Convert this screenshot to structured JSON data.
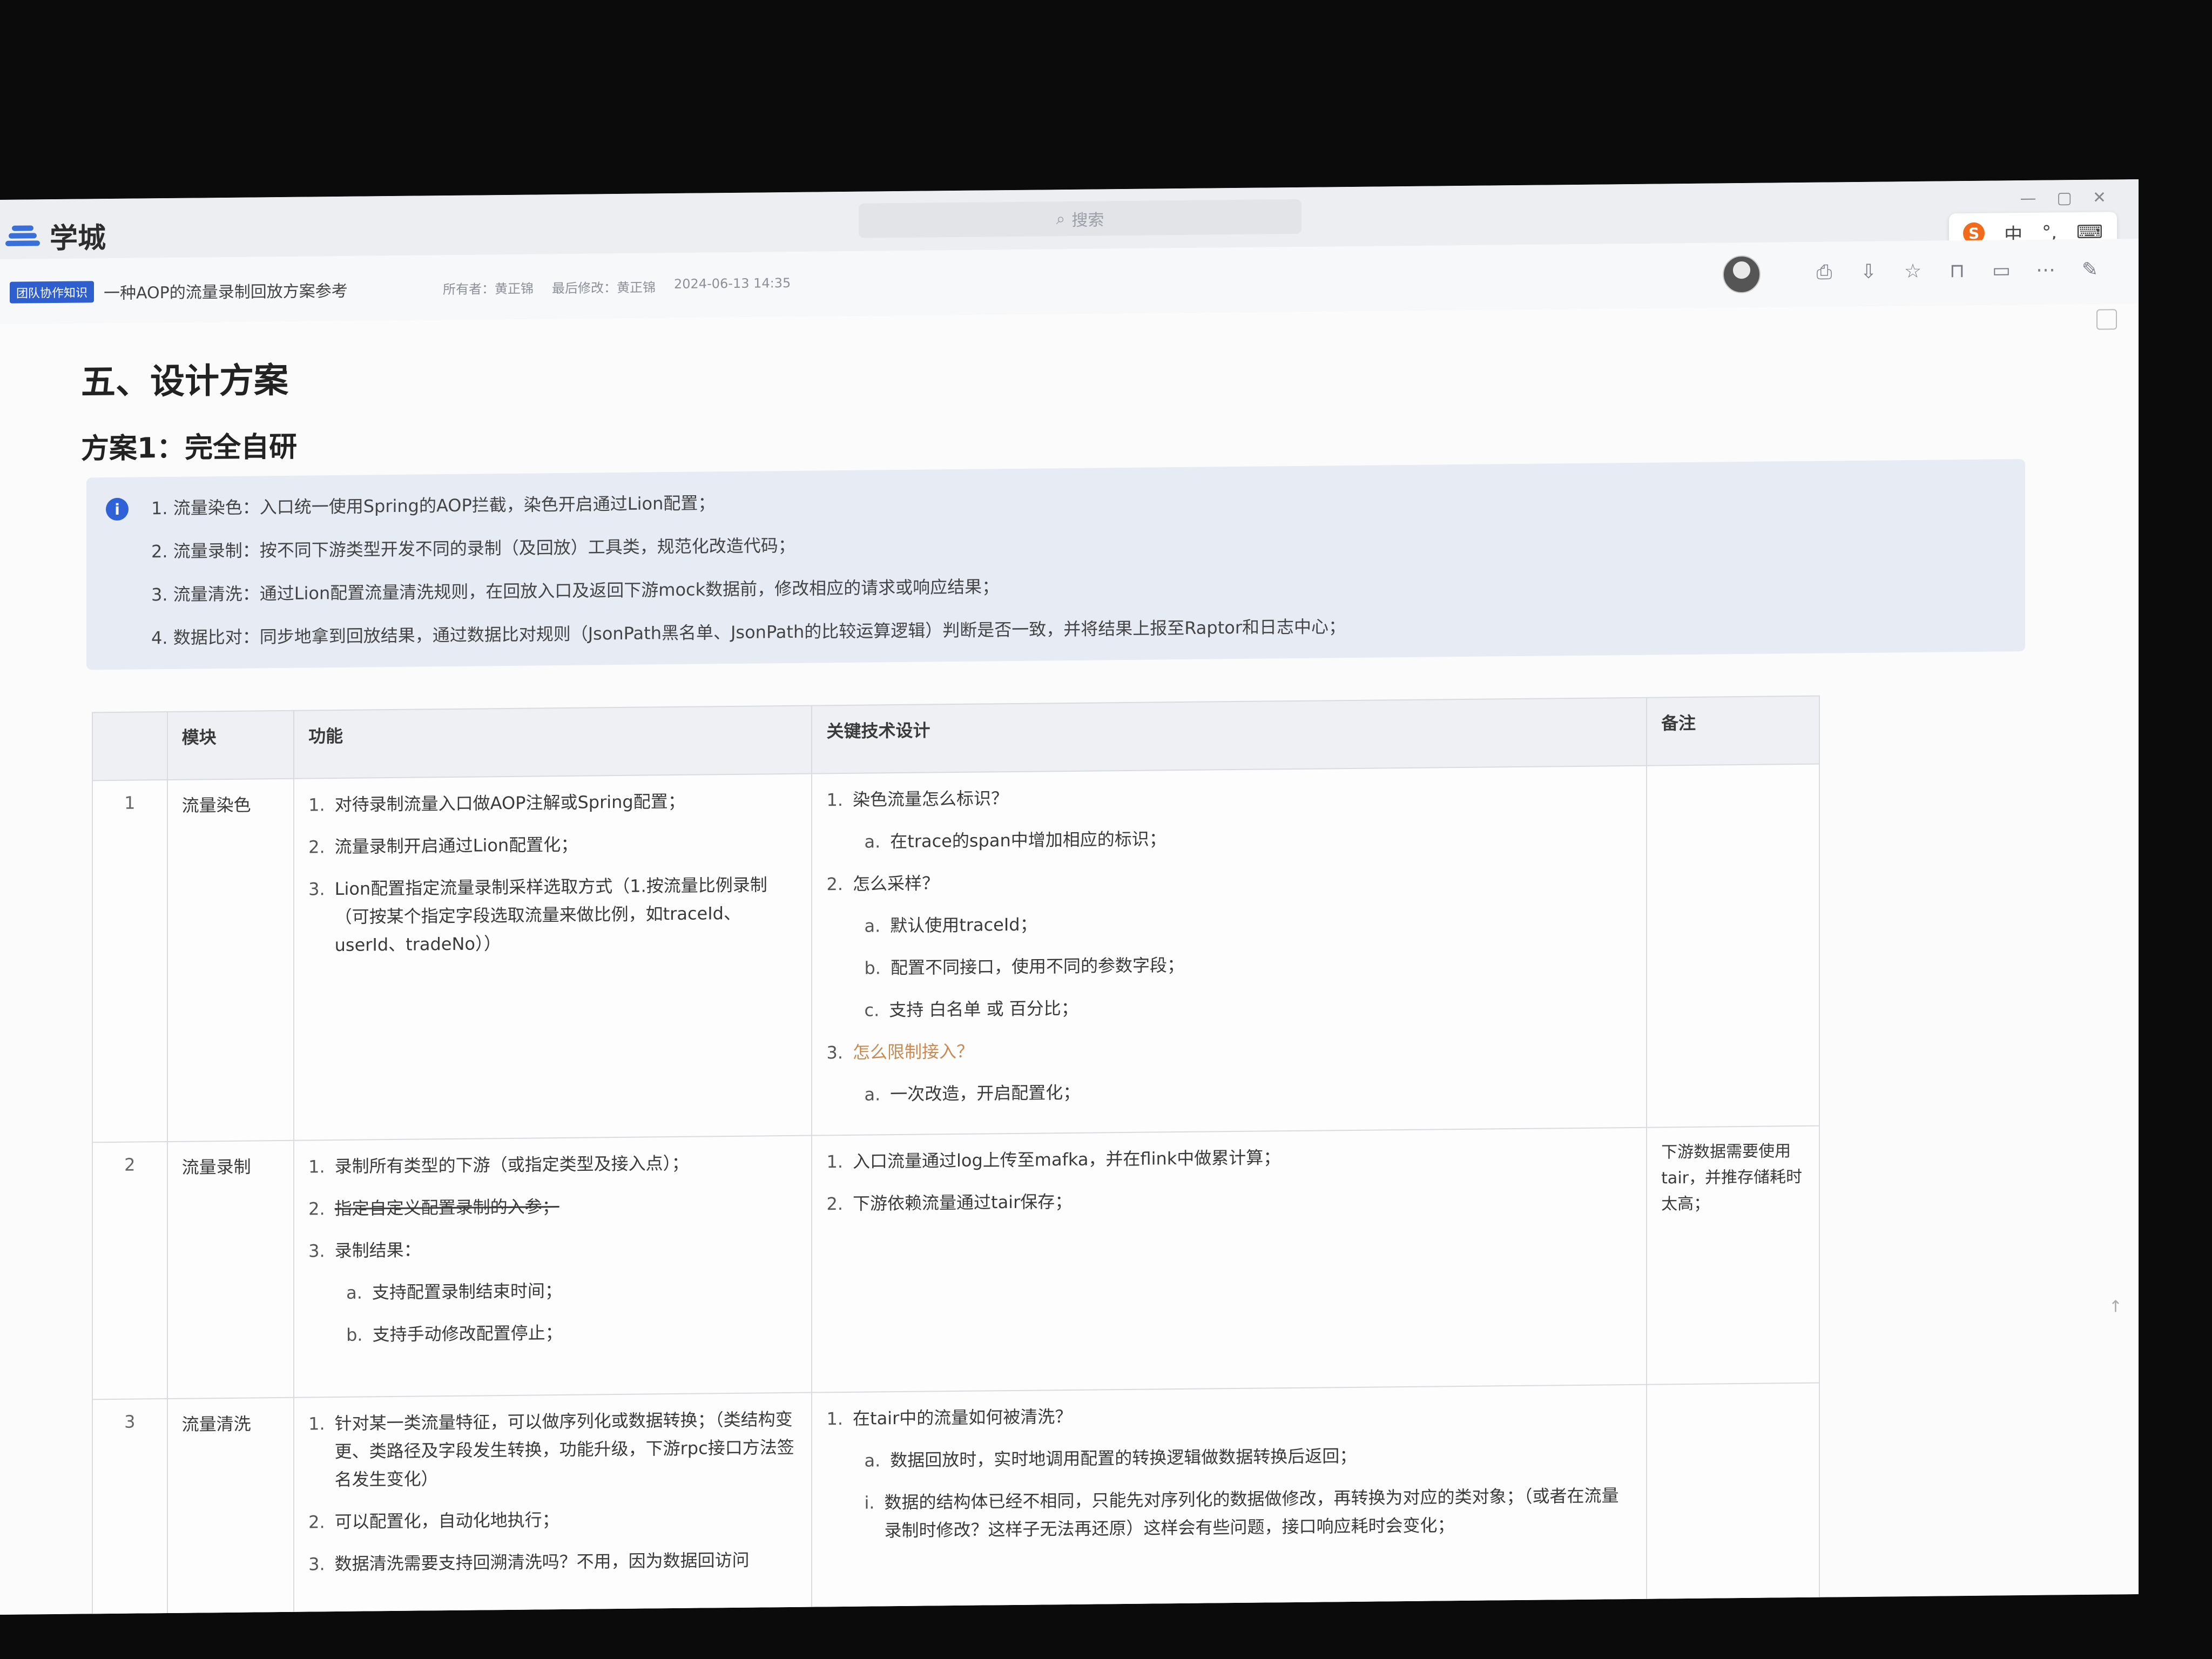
{
  "app": {
    "name": "学城",
    "search_placeholder": "搜索",
    "window_controls": [
      "—",
      "▢",
      "✕"
    ]
  },
  "ime": {
    "brand": "S",
    "items": [
      "中",
      "°,",
      "⌨"
    ]
  },
  "doc": {
    "badge": "团队协作知识",
    "title": "一种AOP的流量录制回放方案参考",
    "owner_label": "所有者：黄正锦",
    "editor_label": "最后修改：黄正锦",
    "updated": "2024-06-13 14:35"
  },
  "toolbar_icons": [
    "share-icon",
    "export-icon",
    "star-icon",
    "lock-icon",
    "comment-icon",
    "more-icon",
    "edit-icon"
  ],
  "section": {
    "h1": "五、设计方案",
    "h2": "方案1：完全自研"
  },
  "callout": {
    "icon": "i",
    "items": [
      "1. 流量染色：入口统一使用Spring的AOP拦截，染色开启通过Lion配置；",
      "2. 流量录制：按不同下游类型开发不同的录制（及回放）工具类，规范化改造代码；",
      "3. 流量清洗：通过Lion配置流量清洗规则，在回放入口及返回下游mock数据前，修改相应的请求或响应结果；",
      "4. 数据比对：同步地拿到回放结果，通过数据比对规则（JsonPath黑名单、JsonPath的比较运算逻辑）判断是否一致，并将结果上报至Raptor和日志中心；"
    ]
  },
  "float_tools": [
    "⎘",
    "⊡"
  ],
  "table": {
    "headers": [
      "",
      "模块",
      "功能",
      "关键技术设计",
      "备注"
    ],
    "rows": [
      {
        "idx": "1",
        "module": "流量染色",
        "features": [
          {
            "n": "1.",
            "t": "对待录制流量入口做AOP注解或Spring配置；"
          },
          {
            "n": "2.",
            "t": "流量录制开启通过Lion配置化；"
          },
          {
            "n": "3.",
            "t": "Lion配置指定流量录制采样选取方式（1.按流量比例录制（可按某个指定字段选取流量来做比例，如traceId、userId、tradeNo））"
          }
        ],
        "design": [
          {
            "n": "1.",
            "t": "染色流量怎么标识？",
            "sub": false
          },
          {
            "n": "a.",
            "t": "在trace的span中增加相应的标识；",
            "sub": true
          },
          {
            "n": "2.",
            "t": "怎么采样？",
            "sub": false
          },
          {
            "n": "a.",
            "t": "默认使用traceId；",
            "sub": true
          },
          {
            "n": "b.",
            "t": "配置不同接口，使用不同的参数字段；",
            "sub": true
          },
          {
            "n": "c.",
            "t": "支持 白名单 或 百分比；",
            "sub": true
          },
          {
            "n": "3.",
            "t": "怎么限制接入？",
            "sub": false,
            "hl": true
          },
          {
            "n": "a.",
            "t": "一次改造，开启配置化；",
            "sub": true
          }
        ],
        "note": ""
      },
      {
        "idx": "2",
        "module": "流量录制",
        "features": [
          {
            "n": "1.",
            "t": "录制所有类型的下游（或指定类型及接入点）；"
          },
          {
            "n": "2.",
            "t": "指定自定义配置录制的入参；",
            "strike": true
          },
          {
            "n": "3.",
            "t": "录制结果："
          },
          {
            "n": "a.",
            "t": "支持配置录制结束时间；",
            "sub": true
          },
          {
            "n": "b.",
            "t": "支持手动修改配置停止；",
            "sub": true
          }
        ],
        "design": [
          {
            "n": "1.",
            "t": "入口流量通过log上传至mafka，并在flink中做累计算；",
            "sub": false
          },
          {
            "n": "2.",
            "t": "下游依赖流量通过tair保存；",
            "sub": false
          }
        ],
        "note": "下游数据需要使用tair，并推存储耗时太高；"
      },
      {
        "idx": "3",
        "module": "流量清洗",
        "features": [
          {
            "n": "1.",
            "t": "针对某一类流量特征，可以做序列化或数据转换；（类结构变更、类路径及字段发生转换，功能升级，下游rpc接口方法签名发生变化）"
          },
          {
            "n": "2.",
            "t": "可以配置化，自动化地执行；"
          },
          {
            "n": "3.",
            "t": "数据清洗需要支持回溯清洗吗？不用，因为数据回访问"
          }
        ],
        "design": [
          {
            "n": "1.",
            "t": "在tair中的流量如何被清洗？",
            "sub": false
          },
          {
            "n": "a.",
            "t": "数据回放时，实时地调用配置的转换逻辑做数据转换后返回；",
            "sub": true
          },
          {
            "n": "i.",
            "t": "数据的结构体已经不相同，只能先对序列化的数据做修改，再转换为对应的类对象；（或者在流量录制时修改？这样子无法再还原）这样会有些问题，接口响应耗时会变化；",
            "sub": true
          }
        ],
        "note": ""
      }
    ]
  }
}
